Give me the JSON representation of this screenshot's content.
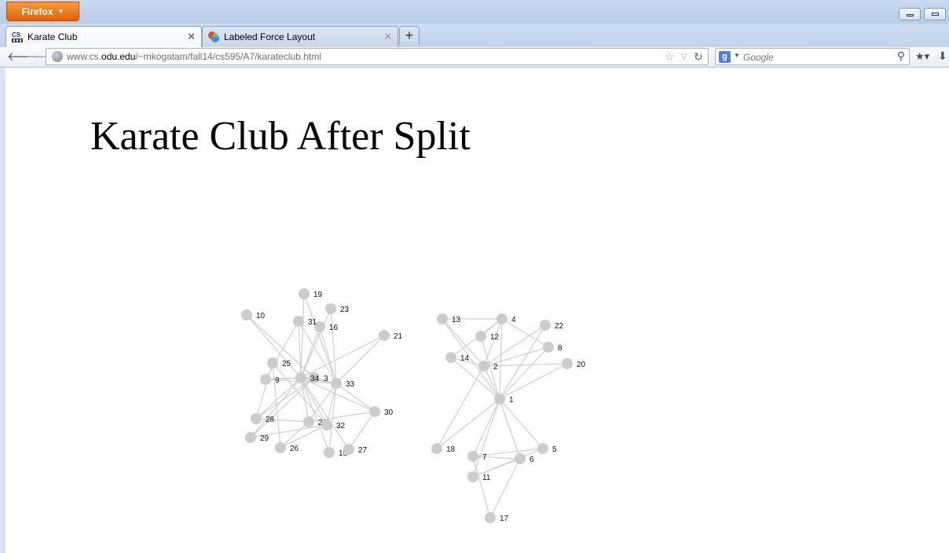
{
  "browser": {
    "menu_button": "Firefox",
    "tabs": [
      {
        "label": "Karate Club",
        "favicon": "cs-odu-icon"
      },
      {
        "label": "Labeled Force Layout",
        "favicon": "puzzle-icon"
      }
    ],
    "url_host_prefix": "www.cs.",
    "url_host_domain": "odu.edu",
    "url_path": "/~mkogatam/fall14/cs595/A7/karateclub.html",
    "search_placeholder": "Google",
    "search_engine_letter": "g"
  },
  "page": {
    "heading": "Karate Club After Split"
  },
  "graph": {
    "nodes": [
      {
        "id": "1",
        "label": "1"
      },
      {
        "id": "2",
        "label": "2"
      },
      {
        "id": "3",
        "label": "3"
      },
      {
        "id": "4",
        "label": "4"
      },
      {
        "id": "5",
        "label": "5"
      },
      {
        "id": "6",
        "label": "6"
      },
      {
        "id": "7",
        "label": "7"
      },
      {
        "id": "8",
        "label": "8"
      },
      {
        "id": "9",
        "label": "9"
      },
      {
        "id": "10",
        "label": "10"
      },
      {
        "id": "11",
        "label": "11"
      },
      {
        "id": "12",
        "label": "12"
      },
      {
        "id": "13",
        "label": "13"
      },
      {
        "id": "14",
        "label": "14"
      },
      {
        "id": "15",
        "label": "15"
      },
      {
        "id": "16",
        "label": "16"
      },
      {
        "id": "17",
        "label": "17"
      },
      {
        "id": "18",
        "label": "18"
      },
      {
        "id": "19",
        "label": "19"
      },
      {
        "id": "20",
        "label": "20"
      },
      {
        "id": "21",
        "label": "21"
      },
      {
        "id": "22",
        "label": "22"
      },
      {
        "id": "23",
        "label": "23"
      },
      {
        "id": "24",
        "label": "24"
      },
      {
        "id": "25",
        "label": "25"
      },
      {
        "id": "26",
        "label": "26"
      },
      {
        "id": "27",
        "label": "27"
      },
      {
        "id": "28",
        "label": "28"
      },
      {
        "id": "29",
        "label": "29"
      },
      {
        "id": "30",
        "label": "30"
      },
      {
        "id": "31",
        "label": "31"
      },
      {
        "id": "32",
        "label": "32"
      },
      {
        "id": "33",
        "label": "33"
      },
      {
        "id": "34",
        "label": "34"
      }
    ],
    "edges": [
      [
        "1",
        "2"
      ],
      [
        "1",
        "4"
      ],
      [
        "1",
        "5"
      ],
      [
        "1",
        "6"
      ],
      [
        "1",
        "7"
      ],
      [
        "1",
        "8"
      ],
      [
        "1",
        "11"
      ],
      [
        "1",
        "12"
      ],
      [
        "1",
        "13"
      ],
      [
        "1",
        "14"
      ],
      [
        "1",
        "18"
      ],
      [
        "1",
        "20"
      ],
      [
        "1",
        "22"
      ],
      [
        "2",
        "4"
      ],
      [
        "2",
        "8"
      ],
      [
        "2",
        "14"
      ],
      [
        "2",
        "18"
      ],
      [
        "2",
        "20"
      ],
      [
        "2",
        "22"
      ],
      [
        "4",
        "8"
      ],
      [
        "4",
        "13"
      ],
      [
        "4",
        "14"
      ],
      [
        "5",
        "7"
      ],
      [
        "5",
        "11"
      ],
      [
        "6",
        "7"
      ],
      [
        "6",
        "11"
      ],
      [
        "6",
        "17"
      ],
      [
        "7",
        "17"
      ],
      [
        "12",
        "4"
      ],
      [
        "13",
        "2"
      ],
      [
        "3",
        "9"
      ],
      [
        "3",
        "10"
      ],
      [
        "3",
        "28"
      ],
      [
        "3",
        "29"
      ],
      [
        "3",
        "33"
      ],
      [
        "3",
        "34"
      ],
      [
        "9",
        "31"
      ],
      [
        "9",
        "33"
      ],
      [
        "9",
        "34"
      ],
      [
        "10",
        "34"
      ],
      [
        "15",
        "33"
      ],
      [
        "15",
        "34"
      ],
      [
        "16",
        "33"
      ],
      [
        "16",
        "34"
      ],
      [
        "19",
        "33"
      ],
      [
        "19",
        "34"
      ],
      [
        "21",
        "33"
      ],
      [
        "21",
        "34"
      ],
      [
        "23",
        "33"
      ],
      [
        "23",
        "34"
      ],
      [
        "24",
        "26"
      ],
      [
        "24",
        "28"
      ],
      [
        "24",
        "30"
      ],
      [
        "24",
        "33"
      ],
      [
        "24",
        "34"
      ],
      [
        "25",
        "26"
      ],
      [
        "25",
        "28"
      ],
      [
        "25",
        "32"
      ],
      [
        "26",
        "32"
      ],
      [
        "27",
        "30"
      ],
      [
        "27",
        "34"
      ],
      [
        "28",
        "34"
      ],
      [
        "29",
        "32"
      ],
      [
        "29",
        "34"
      ],
      [
        "30",
        "33"
      ],
      [
        "30",
        "34"
      ],
      [
        "31",
        "33"
      ],
      [
        "31",
        "34"
      ],
      [
        "32",
        "33"
      ],
      [
        "32",
        "34"
      ],
      [
        "33",
        "34"
      ]
    ]
  }
}
